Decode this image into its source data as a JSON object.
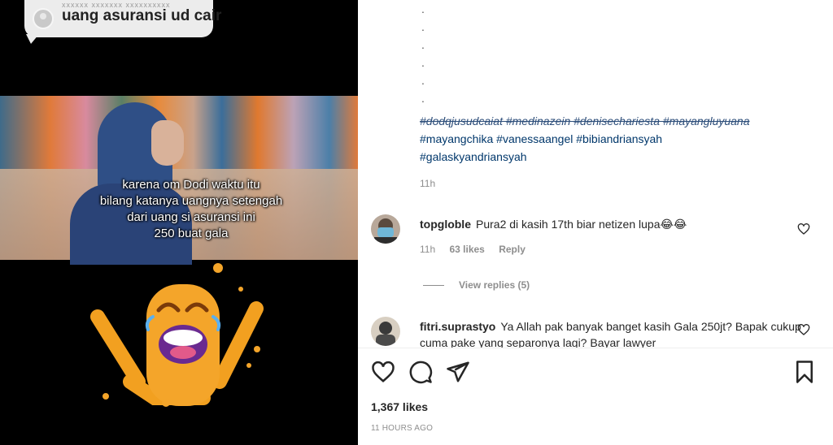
{
  "video": {
    "bubble_faded": "xxxxxx xxxxxxx xxxxxxxxxx",
    "bubble_text": "uang asuransi ud cair",
    "caption_lines": [
      "karena om Dodi waktu itu",
      "bilang katanya uangnya setengah",
      "dari uang si asuransi ini",
      "250 buat gala"
    ],
    "sticker": "LOL"
  },
  "post": {
    "hashtags_strike": "#dodqjusudcaiat #medinazein #denisechariesta #mayangluyuana",
    "hashtags_line2": "#mayangchika #vanessaangel #bibiandriansyah",
    "hashtags_line3": "#galaskyandriansyah",
    "caption_time": "11h",
    "comments": [
      {
        "username": "topgloble",
        "text": "Pura2 di kasih 17th biar netizen lupa😂😂",
        "time": "11h",
        "likes": "63 likes",
        "reply": "Reply"
      },
      {
        "username": "fitri.suprastyo",
        "text": "Ya Allah pak banyak banget kasih Gala 250jt? Bapak cukup cuma pake yang separonya lagi? Bayar lawyer"
      }
    ],
    "view_replies": "View replies (5)",
    "likes": "1,367 likes",
    "time_ago": "11 HOURS AGO"
  },
  "icons": [
    "heart-icon",
    "comment-icon",
    "share-icon",
    "bookmark-icon",
    "small-heart-icon"
  ],
  "colors": {
    "link": "#00376b",
    "muted": "#8e8e8e",
    "text": "#262626",
    "sticker": "#f2a020"
  }
}
